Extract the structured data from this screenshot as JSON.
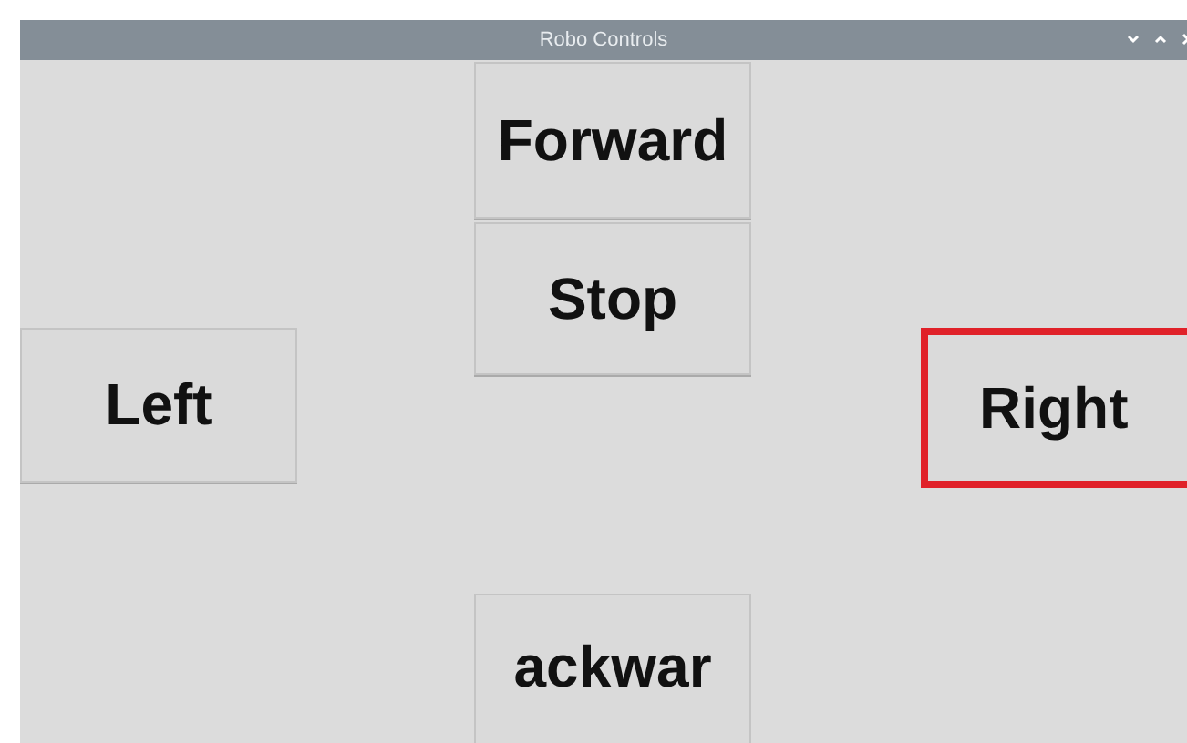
{
  "window": {
    "title": "Robo Controls"
  },
  "buttons": [
    {
      "kind": "forward",
      "label": "Forward",
      "focused": false
    },
    {
      "kind": "stop",
      "label": "Stop",
      "focused": false
    },
    {
      "kind": "left",
      "label": "Left",
      "focused": false
    },
    {
      "kind": "right",
      "label": "Right",
      "focused": true
    },
    {
      "kind": "backward",
      "label": "ackwar",
      "focused": false
    }
  ]
}
